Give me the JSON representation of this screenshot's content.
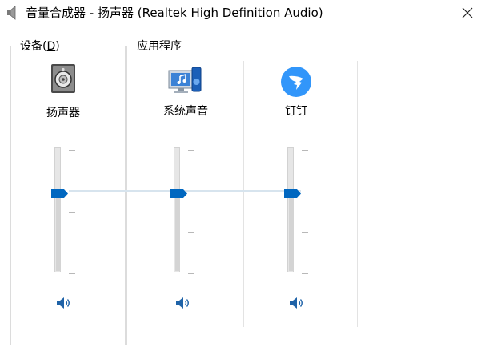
{
  "window": {
    "title": "音量合成器 - 扬声器 (Realtek High Definition Audio)",
    "icons": {
      "title": "speaker-icon",
      "close": "close-icon"
    }
  },
  "groups": {
    "devices": {
      "label_prefix": "设备(",
      "access_key": "D",
      "label_suffix": ")"
    },
    "applications": {
      "label": "应用程序"
    }
  },
  "channels": [
    {
      "name": "扬声器",
      "icon": "speaker-device-icon",
      "volume_percent": 64,
      "muted": false
    },
    {
      "name": "系统声音",
      "icon": "system-sounds-icon",
      "volume_percent": 64,
      "muted": false
    },
    {
      "name": "钉钉",
      "icon": "dingtalk-icon",
      "volume_percent": 64,
      "muted": false
    }
  ],
  "colors": {
    "accent": "#0067c0",
    "dingtalk": "#3296fa",
    "track": "#e6e6e6",
    "border": "#dcdcdc"
  }
}
